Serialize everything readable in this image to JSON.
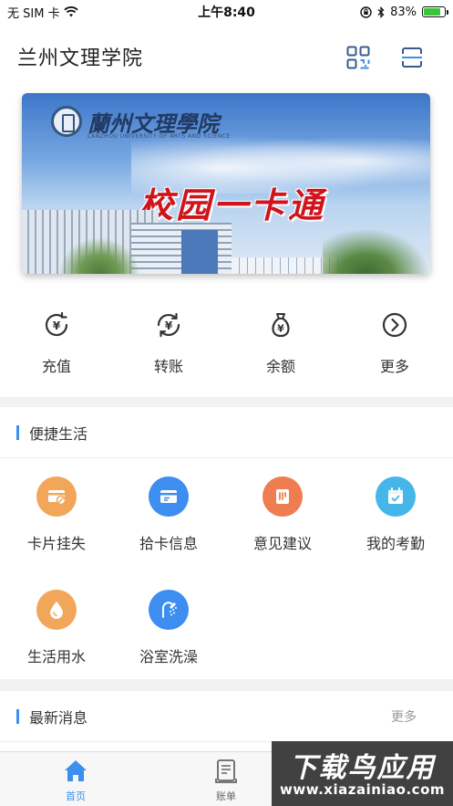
{
  "status_bar": {
    "carrier": "无 SIM 卡",
    "time": "上午8:40",
    "battery_percent": "83%",
    "battery_level": 0.83
  },
  "header": {
    "title": "兰州文理学院"
  },
  "banner": {
    "school_name": "蘭州文理學院",
    "school_name_en": "LANZHOU UNIVERSITY OF ARTS AND SCIENCE",
    "headline": "校园一卡通"
  },
  "quick_actions": [
    {
      "label": "充值",
      "icon": "yuan-recharge-icon"
    },
    {
      "label": "转账",
      "icon": "yuan-transfer-icon"
    },
    {
      "label": "余额",
      "icon": "money-bag-icon"
    },
    {
      "label": "更多",
      "icon": "chevron-circle-icon"
    }
  ],
  "life_section": {
    "title": "便捷生活",
    "items": [
      {
        "label": "卡片挂失",
        "icon": "card-lost-icon",
        "color": "#f2a65a"
      },
      {
        "label": "拾卡信息",
        "icon": "card-found-icon",
        "color": "#3d8ef0"
      },
      {
        "label": "意见建议",
        "icon": "feedback-icon",
        "color": "#ee7d4f"
      },
      {
        "label": "我的考勤",
        "icon": "calendar-check-icon",
        "color": "#45b6ea"
      },
      {
        "label": "生活用水",
        "icon": "water-drop-icon",
        "color": "#f2a65a"
      },
      {
        "label": "浴室洗澡",
        "icon": "shower-icon",
        "color": "#3d8ef0"
      }
    ]
  },
  "news_section": {
    "title": "最新消息",
    "more": "更多"
  },
  "tabbar": {
    "tabs": [
      {
        "label": "首页",
        "icon": "home-icon",
        "active": true
      },
      {
        "label": "账单",
        "icon": "bill-icon",
        "active": false
      }
    ]
  },
  "watermark": {
    "line1": "下载鸟应用",
    "line2": "www.xiazainiao.com"
  },
  "colors": {
    "accent": "#3a8ff0",
    "headline_red": "#d0141b"
  }
}
